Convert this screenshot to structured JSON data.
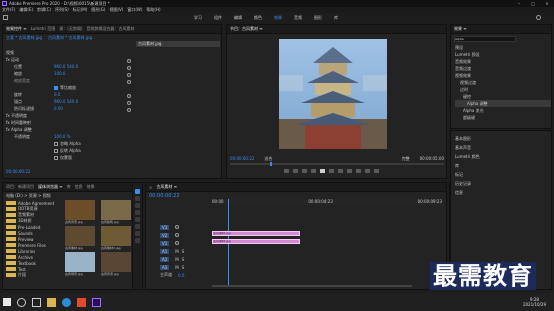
{
  "titlebar": {
    "title": "Adobe Premiere Pro 2020 - D:\\视频\\0015\\新建项目 *",
    "menus": [
      "文件(F)",
      "编辑(E)",
      "剪辑(C)",
      "序列(S)",
      "标记(M)",
      "图形(G)",
      "视图(V)",
      "窗口(W)",
      "帮助(H)"
    ]
  },
  "workspaces": [
    "学习",
    "组件",
    "编辑",
    "颜色",
    "效果",
    "音频",
    "图形",
    "库"
  ],
  "effect_controls": {
    "tabs": [
      "效果控件 ≡",
      "Lumetri 范围",
      "源：(无剪辑)",
      "音频剪辑混合器：古风素材"
    ],
    "clip_path": "主要 * 古风素材.jpg",
    "clip_target": "古风素材 * 古风素材.jpg",
    "thumb_label": "古风素材.jpg",
    "rows": [
      {
        "label": "视频",
        "value": ""
      },
      {
        "label": "fx 运动",
        "value": ""
      },
      {
        "label": "位置",
        "value": "960.0  540.0"
      },
      {
        "label": "缩放",
        "value": "100.0"
      },
      {
        "label": "缩放宽度",
        "value": ""
      },
      {
        "label": "",
        "value": "等比缩放"
      },
      {
        "label": "旋转",
        "value": "0.0"
      },
      {
        "label": "锚点",
        "value": "960.0  540.0"
      },
      {
        "label": "防闪烁滤镜",
        "value": "0.00"
      },
      {
        "label": "fx 不透明度",
        "value": ""
      },
      {
        "label": "fx 时间重映射",
        "value": ""
      },
      {
        "label": "fx Alpha 调整",
        "value": ""
      },
      {
        "label": "不透明度",
        "value": "100.0 %"
      },
      {
        "label": "",
        "value": "忽略 Alpha"
      },
      {
        "label": "",
        "value": "反转 Alpha"
      },
      {
        "label": "",
        "value": "仅蒙版"
      }
    ],
    "timecode": "00:00:00:22"
  },
  "program": {
    "tab": "节目：古风素材 ≡",
    "timecode_left": "00:00:00:22",
    "fit": "适合",
    "quality": "完整",
    "timecode_right": "00:00:05:00"
  },
  "project": {
    "tabs": [
      "项目：新建项目",
      "媒体浏览器 ≡",
      "库",
      "信息",
      "效果"
    ],
    "path": "电脑 (D:) > 资源 > 视频",
    "folders": [
      "Adobe Agreement",
      "OOTB资源",
      "音频素材",
      "3D材质",
      "Pre-Loaded",
      "Sounds",
      "Preview",
      "Premiere Files",
      "Libraries",
      "Archive",
      "Textbook",
      "Test",
      "片段"
    ],
    "items": [
      {
        "name": "古风背景.jpg",
        "dur": ""
      },
      {
        "name": "古风建筑.jpg",
        "dur": ""
      },
      {
        "name": "古风素材.jpg",
        "dur": ""
      },
      {
        "name": "古风素材2.jpg",
        "dur": ""
      },
      {
        "name": "古风场景.jpg",
        "dur": ""
      },
      {
        "name": "古风风景.jpg",
        "dur": ""
      },
      {
        "name": "古风素材.jpg",
        "dur": ""
      }
    ]
  },
  "timeline": {
    "tab": "古风素材 ≡",
    "timecode": "00:00:00:22",
    "ruler": [
      "00:00",
      "00:00:04:23",
      "00:00:09:23"
    ],
    "tracks": [
      "V3",
      "V2",
      "V1",
      "A1",
      "A2",
      "A3"
    ],
    "clip_v2": "古风素材.jpg",
    "clip_v1": "古风素材.jpg",
    "master": "主声道",
    "master_value": "0.0"
  },
  "effects_panel": {
    "title": "效果 ≡",
    "search_placeholder": "Alpha",
    "items": [
      "预设",
      "Lumetri 预设",
      "音频效果",
      "音频过渡",
      "视频效果",
      "视频过渡",
      "过时",
      "键控",
      "Alpha 调整",
      "Alpha 发光",
      "超级键"
    ]
  },
  "right_lower": {
    "items": [
      "基本图形",
      "基本声音",
      "Lumetri 颜色",
      "库",
      "标记",
      "历史记录",
      "信息"
    ]
  },
  "watermark": "最需教育",
  "taskbar": {
    "time": "9:28",
    "date": "2021/10/29"
  }
}
